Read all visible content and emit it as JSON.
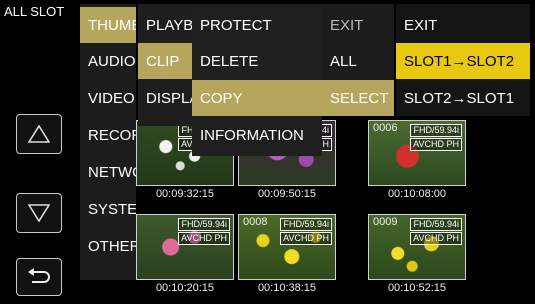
{
  "slot_label": "ALL SLOT",
  "header_meta": "",
  "nav": {
    "up_icon": "triangle-up-icon",
    "down_icon": "triangle-down-icon",
    "back_icon": "return-arrow-icon"
  },
  "menu": {
    "categories": [
      "THUMBNAIL",
      "AUDIO",
      "VIDEO",
      "RECORDING",
      "NETWORK",
      "SYSTEM",
      "OTHERS"
    ],
    "thumbnail_submenu": [
      "PLAYBACK",
      "CLIP",
      "DISPLAY"
    ],
    "clip_submenu": [
      "PROTECT",
      "DELETE",
      "COPY",
      "INFORMATION"
    ],
    "copy_options": [
      "EXIT",
      "ALL",
      "SELECT"
    ],
    "select_options": [
      "EXIT",
      "SLOT1→SLOT2",
      "SLOT2→SLOT1"
    ]
  },
  "thumbnails": [
    {
      "number": "",
      "format": "FHD/59.94i",
      "codec": "AVCHD PH",
      "timecode": "00:09:32:15",
      "scene": "white-flowers"
    },
    {
      "number": "",
      "format": "FHD/59.94i",
      "codec": "AVCHD PH",
      "timecode": "00:09:50:15",
      "scene": "purple-flowers"
    },
    {
      "number": "0006",
      "format": "FHD/59.94i",
      "codec": "AVCHD PH",
      "timecode": "00:10:08:00",
      "scene": "red-flower"
    },
    {
      "number": "",
      "format": "FHD/59.94i",
      "codec": "AVCHD PH",
      "timecode": "00:10:20:15",
      "scene": "pink-flowers"
    },
    {
      "number": "0008",
      "format": "FHD/59.94i",
      "codec": "AVCHD PH",
      "timecode": "00:10:38:15",
      "scene": "yellow-flowers"
    },
    {
      "number": "0009",
      "format": "FHD/59.94i",
      "codec": "AVCHD PH",
      "timecode": "00:10:52:15",
      "scene": "yellow-flowers-2"
    }
  ]
}
